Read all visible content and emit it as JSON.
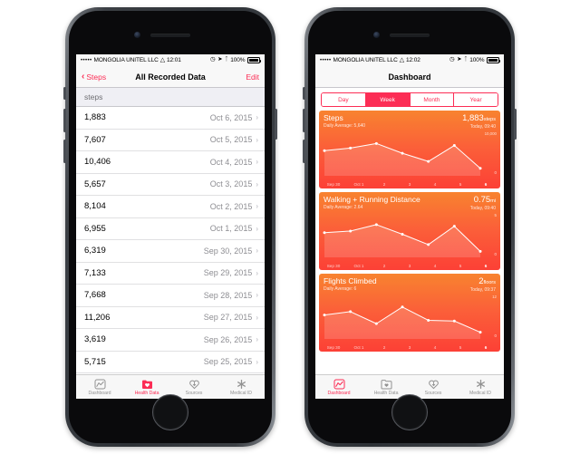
{
  "left_phone": {
    "status_bar": {
      "signal_dots": "•••••",
      "carrier": "MONGOLIA UNITEL LLC",
      "wifi_icon": "wifi-icon",
      "time": "12:01",
      "alarm_icon": "alarm-clock-icon",
      "location_icon": "location-arrow-icon",
      "bluetooth_icon": "bluetooth-icon",
      "battery_percent": "100%"
    },
    "nav": {
      "back_label": "Steps",
      "back_icon": "chevron-left-icon",
      "title": "All Recorded Data",
      "edit_label": "Edit"
    },
    "section_header": "steps",
    "rows": [
      {
        "value": "1,883",
        "date": "Oct 6, 2015"
      },
      {
        "value": "7,607",
        "date": "Oct 5, 2015"
      },
      {
        "value": "10,406",
        "date": "Oct 4, 2015"
      },
      {
        "value": "5,657",
        "date": "Oct 3, 2015"
      },
      {
        "value": "8,104",
        "date": "Oct 2, 2015"
      },
      {
        "value": "6,955",
        "date": "Oct 1, 2015"
      },
      {
        "value": "6,319",
        "date": "Sep 30, 2015"
      },
      {
        "value": "7,133",
        "date": "Sep 29, 2015"
      },
      {
        "value": "7,668",
        "date": "Sep 28, 2015"
      },
      {
        "value": "11,206",
        "date": "Sep 27, 2015"
      },
      {
        "value": "3,619",
        "date": "Sep 26, 2015"
      },
      {
        "value": "5,715",
        "date": "Sep 25, 2015"
      }
    ],
    "tabs": [
      {
        "label": "Dashboard",
        "icon": "dashboard-chart-icon",
        "active": false
      },
      {
        "label": "Health Data",
        "icon": "health-data-folder-icon",
        "active": true
      },
      {
        "label": "Sources",
        "icon": "sources-heart-icon",
        "active": false
      },
      {
        "label": "Medical ID",
        "icon": "medical-id-asterisk-icon",
        "active": false
      }
    ]
  },
  "right_phone": {
    "status_bar": {
      "signal_dots": "•••••",
      "carrier": "MONGOLIA UNITEL LLC",
      "wifi_icon": "wifi-icon",
      "time": "12:02",
      "alarm_icon": "alarm-clock-icon",
      "location_icon": "location-arrow-icon",
      "bluetooth_icon": "bluetooth-icon",
      "battery_percent": "100%"
    },
    "nav": {
      "title": "Dashboard"
    },
    "segmented": {
      "options": [
        "Day",
        "Week",
        "Month",
        "Year"
      ],
      "selected": "Week",
      "accent_color": "#fc2d55"
    },
    "tabs": [
      {
        "label": "Dashboard",
        "icon": "dashboard-chart-icon",
        "active": true
      },
      {
        "label": "Health Data",
        "icon": "health-data-folder-icon",
        "active": false
      },
      {
        "label": "Sources",
        "icon": "sources-heart-icon",
        "active": false
      },
      {
        "label": "Medical ID",
        "icon": "medical-id-asterisk-icon",
        "active": false
      }
    ]
  },
  "chart_data": [
    {
      "type": "line",
      "title": "Steps",
      "subtitle": "Daily Average: 5,640",
      "value": "1,883",
      "unit": "steps",
      "timestamp": "Today, 09:40",
      "categories": [
        "Sep 30",
        "Oct 1",
        "2",
        "3",
        "4",
        "5",
        "6"
      ],
      "values": [
        6319,
        6955,
        8104,
        5657,
        3600,
        7607,
        1883
      ],
      "ylabel_max": "10,000",
      "ylabel_min": "0",
      "ylim": [
        0,
        10000
      ],
      "gradient_from": "#f8832f",
      "gradient_to": "#fc4036",
      "line_color": "#ffffff",
      "grid": false,
      "legend": "none"
    },
    {
      "type": "line",
      "title": "Walking + Running Distance",
      "subtitle": "Daily Average: 2.64",
      "value": "0.75",
      "unit": "mi",
      "timestamp": "Today, 09:40",
      "categories": [
        "Sep 30",
        "Oct 1",
        "2",
        "3",
        "4",
        "5",
        "6"
      ],
      "values": [
        3.1,
        3.3,
        4.1,
        2.9,
        1.6,
        3.9,
        0.75
      ],
      "ylabel_max": "5",
      "ylabel_min": "0",
      "ylim": [
        0,
        5
      ],
      "gradient_from": "#f8832f",
      "gradient_to": "#fc4036",
      "line_color": "#ffffff",
      "grid": false,
      "legend": "none"
    },
    {
      "type": "line",
      "title": "Flights Climbed",
      "subtitle": "Daily Average: 6",
      "value": "2",
      "unit": "floors",
      "timestamp": "Today, 09:37",
      "categories": [
        "Sep 30",
        "Oct 1",
        "2",
        "3",
        "4",
        "5",
        "6"
      ],
      "values": [
        7.2,
        8.2,
        4.6,
        9.6,
        5.6,
        5.4,
        2
      ],
      "ylabel_max": "12",
      "ylabel_min": "0",
      "ylim": [
        0,
        12
      ],
      "gradient_from": "#f8832f",
      "gradient_to": "#fc4036",
      "line_color": "#ffffff",
      "grid": false,
      "legend": "none"
    }
  ]
}
